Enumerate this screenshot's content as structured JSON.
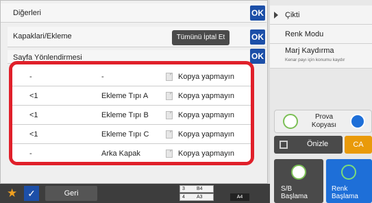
{
  "dialog": {
    "title": "Diğerleri",
    "ok": "OK",
    "sections": [
      {
        "label": "Kapaklari/Ekleme"
      },
      {
        "label": "Sayfa Yönlendirmesi"
      }
    ],
    "cancel_all": "Tümünü İptal Et"
  },
  "list": {
    "rows": [
      {
        "page": "-",
        "type": "-",
        "copy": "Kopya yapmayın"
      },
      {
        "page": "<1",
        "type": "Ekleme Tıpı A",
        "copy": "Kopya yapmayın"
      },
      {
        "page": "<1",
        "type": "Ekleme Tıpı B",
        "copy": "Kopya yapmayın"
      },
      {
        "page": "<1",
        "type": "Ekleme Tıpı C",
        "copy": "Kopya yapmayın"
      },
      {
        "page": "-",
        "type": "Arka Kapak",
        "copy": "Kopya yapmayın"
      }
    ]
  },
  "right_panel": {
    "items": [
      {
        "label": "Çikti"
      },
      {
        "label": "Renk Modu"
      },
      {
        "label": "Marj Kaydırma",
        "sub": "Kenar payı için konumu kaydır"
      }
    ],
    "prova": "Prova Kopyası",
    "preview": "Önizle",
    "ca": "CA",
    "sb_start": "S/B Başlama",
    "color_start": "Renk Başlama"
  },
  "bottom_bar": {
    "back": "Geri",
    "paper": [
      {
        "num": "3",
        "size": "B4"
      },
      {
        "num": "4",
        "size": "A3"
      }
    ],
    "paper_size": "A4"
  },
  "colors": {
    "accent_blue": "#1c4fa8",
    "highlight_red": "#e0202a",
    "ca_orange": "#e99a0a",
    "renk_blue": "#1e6fd8"
  }
}
